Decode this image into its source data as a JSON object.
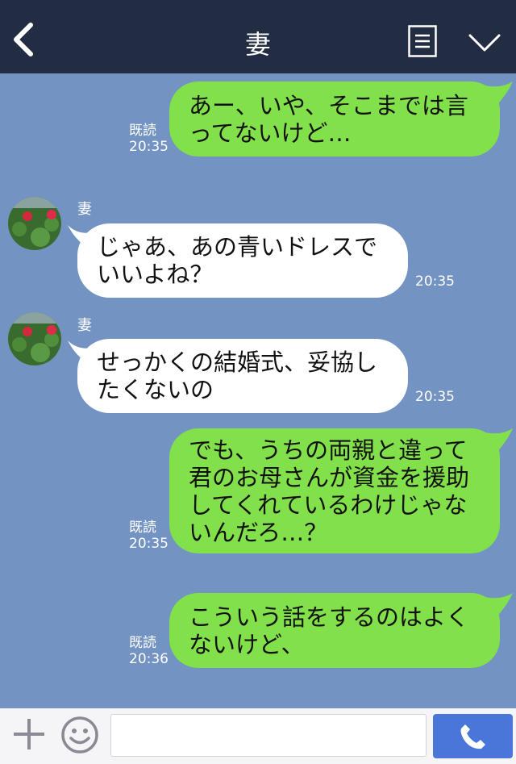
{
  "header": {
    "title": "妻"
  },
  "messages": [
    {
      "side": "out",
      "text": "あー、いや、そこまでは言ってないけど…",
      "read": "既読",
      "time": "20:35"
    },
    {
      "side": "in",
      "sender": "妻",
      "text": "じゃあ、あの青いドレスでいいよね？",
      "time": "20:35"
    },
    {
      "side": "in",
      "sender": "妻",
      "text": "せっかくの結婚式、妥協したくないの",
      "time": "20:35"
    },
    {
      "side": "out",
      "text": "でも、うちの両親と違って君のお母さんが資金を援助してくれているわけじゃないんだろ…？",
      "read": "既読",
      "time": "20:35"
    },
    {
      "side": "out",
      "text": "こういう話をするのはよくないけど、",
      "read": "既読",
      "time": "20:36"
    }
  ],
  "input": {
    "value": ""
  },
  "colors": {
    "header_bg": "#222d44",
    "chat_bg": "#7393c3",
    "outgoing_bubble": "#82e04b",
    "incoming_bubble": "#ffffff",
    "call_button": "#4a76d9"
  },
  "icons": [
    "back-icon",
    "menu-icon",
    "chevron-down-icon",
    "plus-icon",
    "emoji-icon",
    "phone-icon"
  ]
}
